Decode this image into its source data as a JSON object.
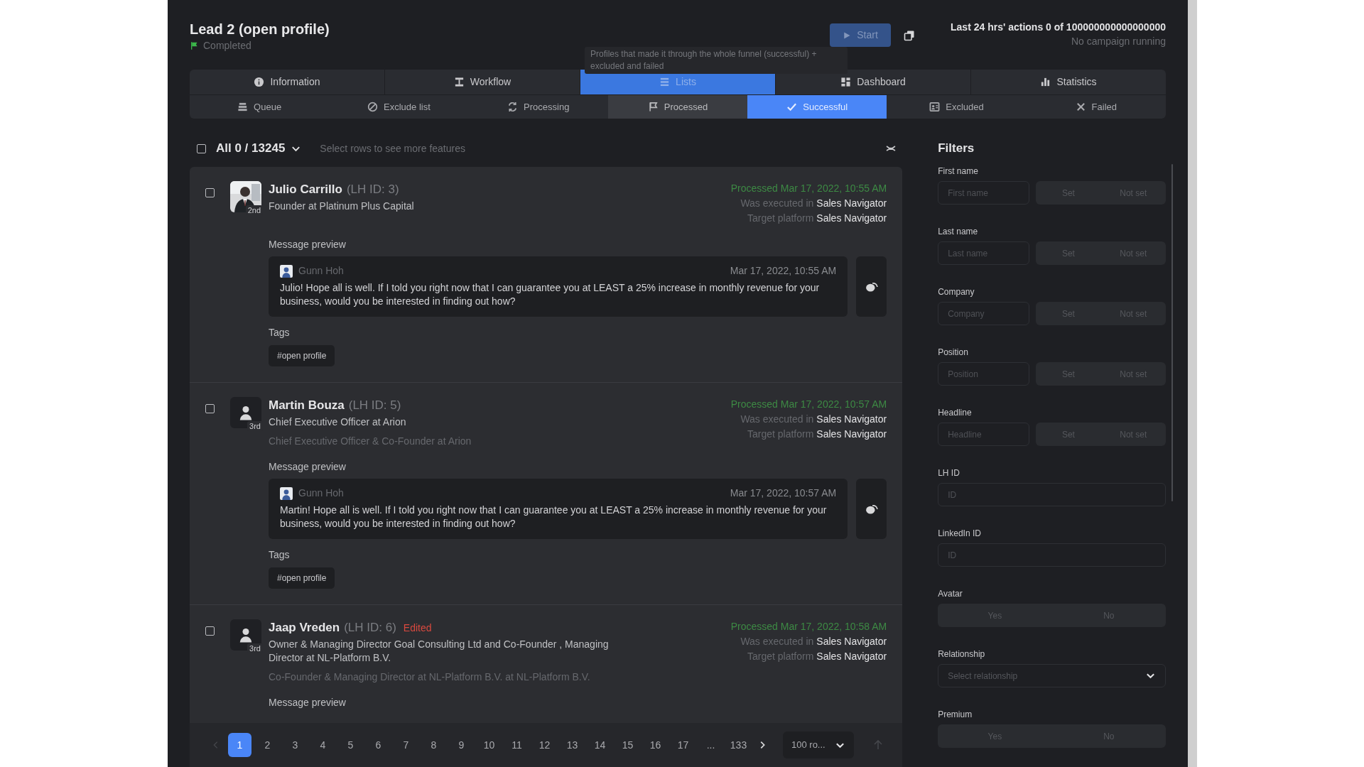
{
  "header": {
    "title": "Lead 2 (open profile)",
    "status": "Completed",
    "start_button": "Start",
    "action_count": "Last 24 hrs' actions 0 of 100000000000000000",
    "campaign_status": "No campaign running"
  },
  "tooltip": "Profiles that made it through the whole funnel (successful) + excluded and failed",
  "main_tabs": [
    {
      "label": "Information",
      "selected": false
    },
    {
      "label": "Workflow",
      "selected": false
    },
    {
      "label": "Lists",
      "selected": true
    },
    {
      "label": "Dashboard",
      "selected": false
    },
    {
      "label": "Statistics",
      "selected": false
    }
  ],
  "sub_tabs": [
    {
      "label": "Queue",
      "selected": false,
      "hovered": false
    },
    {
      "label": "Exclude list",
      "selected": false,
      "hovered": false
    },
    {
      "label": "Processing",
      "selected": false,
      "hovered": false
    },
    {
      "label": "Processed",
      "selected": false,
      "hovered": true
    },
    {
      "label": "Successful",
      "selected": true,
      "hovered": false
    },
    {
      "label": "Excluded",
      "selected": false,
      "hovered": false
    },
    {
      "label": "Failed",
      "selected": false,
      "hovered": false
    }
  ],
  "toolbar": {
    "select_all_checked": false,
    "count": "All 0 / 13245",
    "hint": "Select rows to see more features"
  },
  "leads": [
    {
      "checked": false,
      "degree": "2nd",
      "name": "Julio Carrillo",
      "lh_id": "(LH ID: 3)",
      "position": "Founder at Platinum Plus Capital",
      "processed": "Processed Mar 17, 2022, 10:55 AM",
      "executed_label": "Was executed in",
      "executed_value": "Sales Navigator",
      "platform_label": "Target platform",
      "platform_value": "Sales Navigator",
      "preview_label": "Message preview",
      "message": {
        "sender": "Gunn Hoh",
        "time": "Mar 17, 2022, 10:55 AM",
        "text": "Julio! Hope all is well. If I told you right now that I can guarantee you at LEAST a 25% increase in monthly revenue for your business, would you be interested in finding out how?"
      },
      "tags_label": "Tags",
      "tags": [
        "#open profile"
      ]
    },
    {
      "checked": false,
      "kind": "default",
      "degree": "3rd",
      "name": "Martin Bouza",
      "lh_id": "(LH ID: 5)",
      "position": "Chief Executive Officer at Arion",
      "headline": "Chief Executive Officer & Co-Founder at Arion",
      "processed": "Processed Mar 17, 2022, 10:57 AM",
      "executed_label": "Was executed in",
      "executed_value": "Sales Navigator",
      "platform_label": "Target platform",
      "platform_value": "Sales Navigator",
      "preview_label": "Message preview",
      "message": {
        "sender": "Gunn Hoh",
        "time": "Mar 17, 2022, 10:57 AM",
        "text": "Martin! Hope all is well. If I told you right now that I can guarantee you at LEAST a 25% increase in monthly revenue for your business, would you be interested in finding out how?"
      },
      "tags_label": "Tags",
      "tags": [
        "#open profile"
      ]
    },
    {
      "checked": false,
      "kind": "default",
      "degree": "3rd",
      "name": "Jaap Vreden",
      "lh_id": "(LH ID: 6)",
      "edited": "Edited",
      "position": "Owner & Managing Director Goal Consulting Ltd and Co-Founder , Managing Director at NL-Platform B.V.",
      "headline": "Co-Founder & Managing Director at NL-Platform B.V. at NL-Platform B.V.",
      "processed": "Processed Mar 17, 2022, 10:58 AM",
      "executed_label": "Was executed in",
      "executed_value": "Sales Navigator",
      "platform_label": "Target platform",
      "platform_value": "Sales Navigator",
      "preview_label": "Message preview"
    }
  ],
  "pagination": {
    "pages": [
      {
        "label": "1",
        "selected": true
      },
      {
        "label": "2",
        "selected": false
      },
      {
        "label": "3",
        "selected": false
      },
      {
        "label": "4",
        "selected": false
      },
      {
        "label": "5",
        "selected": false
      },
      {
        "label": "6",
        "selected": false
      },
      {
        "label": "7",
        "selected": false
      },
      {
        "label": "8",
        "selected": false
      },
      {
        "label": "9",
        "selected": false
      },
      {
        "label": "10",
        "selected": false
      },
      {
        "label": "11",
        "selected": false
      },
      {
        "label": "12",
        "selected": false
      },
      {
        "label": "13",
        "selected": false
      },
      {
        "label": "14",
        "selected": false
      },
      {
        "label": "15",
        "selected": false
      },
      {
        "label": "16",
        "selected": false
      },
      {
        "label": "17",
        "selected": false
      },
      {
        "label": "...",
        "selected": false
      },
      {
        "label": "133",
        "selected": false
      }
    ],
    "per_page": "100 ro..."
  },
  "filters": {
    "title": "Filters",
    "fields": [
      {
        "kind": "text_set",
        "label": "First name",
        "placeholder": "First name",
        "options": [
          "Set",
          "Not set"
        ]
      },
      {
        "kind": "text_set",
        "label": "Last name",
        "placeholder": "Last name",
        "options": [
          "Set",
          "Not set"
        ]
      },
      {
        "kind": "text_set",
        "label": "Company",
        "placeholder": "Company",
        "options": [
          "Set",
          "Not set"
        ]
      },
      {
        "kind": "text_set",
        "label": "Position",
        "placeholder": "Position",
        "options": [
          "Set",
          "Not set"
        ]
      },
      {
        "kind": "text_set",
        "label": "Headline",
        "placeholder": "Headline",
        "options": [
          "Set",
          "Not set"
        ]
      },
      {
        "kind": "text",
        "label": "LH ID",
        "placeholder": "ID"
      },
      {
        "kind": "text",
        "label": "LinkedIn ID",
        "placeholder": "ID"
      },
      {
        "kind": "toggle",
        "label": "Avatar",
        "options": [
          "Yes",
          "No"
        ]
      },
      {
        "kind": "select",
        "label": "Relationship",
        "placeholder": "Select relationship"
      },
      {
        "kind": "toggle",
        "label": "Premium",
        "options": [
          "Yes",
          "No"
        ]
      }
    ]
  }
}
